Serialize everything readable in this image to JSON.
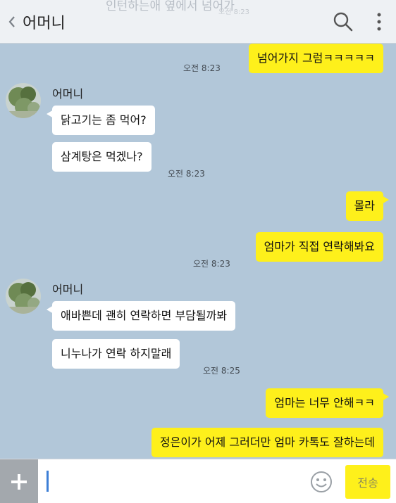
{
  "header": {
    "faded_preview": "인턴하는애 옆에서 넘어가",
    "faded_time": "오전 8:23",
    "title": "어머니"
  },
  "messages": [
    {
      "side": "me",
      "text": "넘어가지 그럼ㅋㅋㅋㅋㅋ",
      "time": "오전 8:23"
    },
    {
      "side": "other",
      "sender": "어머니",
      "text": "닭고기는 좀 먹어?"
    },
    {
      "side": "other",
      "text": "삼계탕은 먹겠나?",
      "time": "오전 8:23"
    },
    {
      "side": "me",
      "text": "몰라"
    },
    {
      "side": "me",
      "text": "엄마가 직접 연락해봐요",
      "time": "오전 8:23"
    },
    {
      "side": "other",
      "sender": "어머니",
      "text": "애바쁜데 괜히 연락하면 부담될까봐"
    },
    {
      "side": "other",
      "text": "니누나가 연락 하지말래",
      "time": "오전 8:25"
    },
    {
      "side": "me",
      "text": "엄마는 너무 안해ㅋㅋ"
    },
    {
      "side": "me",
      "text": "정은이가 어제 그러더만 엄마 카톡도 잘하는데"
    }
  ],
  "input": {
    "value": "",
    "send_label": "전송"
  },
  "colors": {
    "background": "#b2c7d9",
    "my_bubble": "#fef01b",
    "other_bubble": "#ffffff"
  }
}
